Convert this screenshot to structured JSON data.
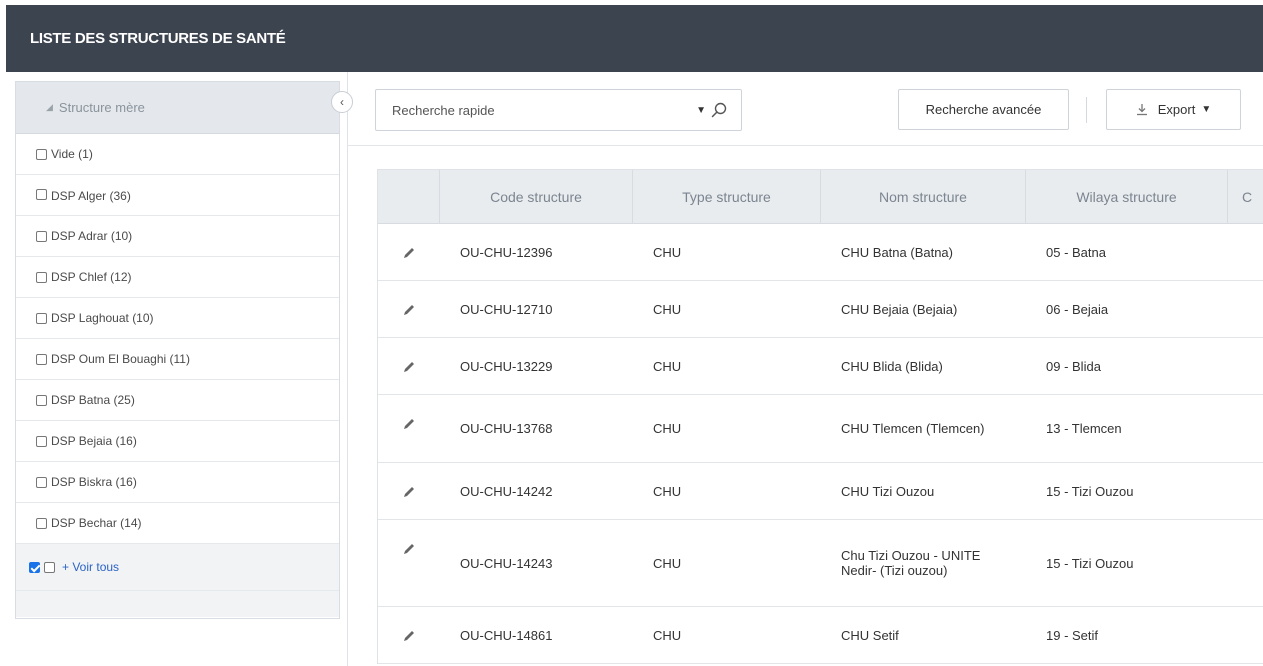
{
  "header": {
    "title": "LISTE DES STRUCTURES DE SANTÉ"
  },
  "sidebar": {
    "title": "Structure mère",
    "items": [
      {
        "label": "Vide",
        "count": "(1)"
      },
      {
        "label": "DSP Alger",
        "count": "(36)"
      },
      {
        "label": "DSP Adrar",
        "count": "(10)"
      },
      {
        "label": "DSP Chlef",
        "count": "(12)"
      },
      {
        "label": "DSP Laghouat",
        "count": "(10)"
      },
      {
        "label": "DSP Oum El Bouaghi",
        "count": "(11)"
      },
      {
        "label": "DSP Batna",
        "count": "(25)"
      },
      {
        "label": "DSP Bejaia",
        "count": "(16)"
      },
      {
        "label": "DSP Biskra",
        "count": "(16)"
      },
      {
        "label": "DSP Bechar",
        "count": "(14)"
      }
    ],
    "see_all_label": "+ Voir tous",
    "collapse_glyph": "‹"
  },
  "toolbar": {
    "search_placeholder": "Recherche rapide",
    "advanced_search_label": "Recherche avancée",
    "export_label": "Export"
  },
  "table": {
    "columns": [
      "Code structure",
      "Type structure",
      "Nom structure",
      "Wilaya structure",
      "C"
    ],
    "rows": [
      {
        "code": "OU-CHU-12396",
        "type": "CHU",
        "nom": "CHU Batna (Batna)",
        "wilaya": "05 - Batna"
      },
      {
        "code": "OU-CHU-12710",
        "type": "CHU",
        "nom": "CHU Bejaia (Bejaia)",
        "wilaya": "06 - Bejaia"
      },
      {
        "code": "OU-CHU-13229",
        "type": "CHU",
        "nom": "CHU Blida (Blida)",
        "wilaya": "09 - Blida"
      },
      {
        "code": "OU-CHU-13768",
        "type": "CHU",
        "nom": "CHU Tlemcen (Tlemcen)",
        "wilaya": "13 - Tlemcen"
      },
      {
        "code": "OU-CHU-14242",
        "type": "CHU",
        "nom": "CHU Tizi Ouzou",
        "wilaya": "15 - Tizi Ouzou"
      },
      {
        "code": "OU-CHU-14243",
        "type": "CHU",
        "nom": "Chu Tizi Ouzou - UNITE Nedir- (Tizi ouzou)",
        "wilaya": "15 - Tizi Ouzou"
      },
      {
        "code": "OU-CHU-14861",
        "type": "CHU",
        "nom": "CHU Setif",
        "wilaya": "19 - Setif"
      }
    ]
  },
  "colors": {
    "header_bg": "#3c4450",
    "checkbox_checked": "#1a73e8",
    "link": "#2b63c6"
  }
}
